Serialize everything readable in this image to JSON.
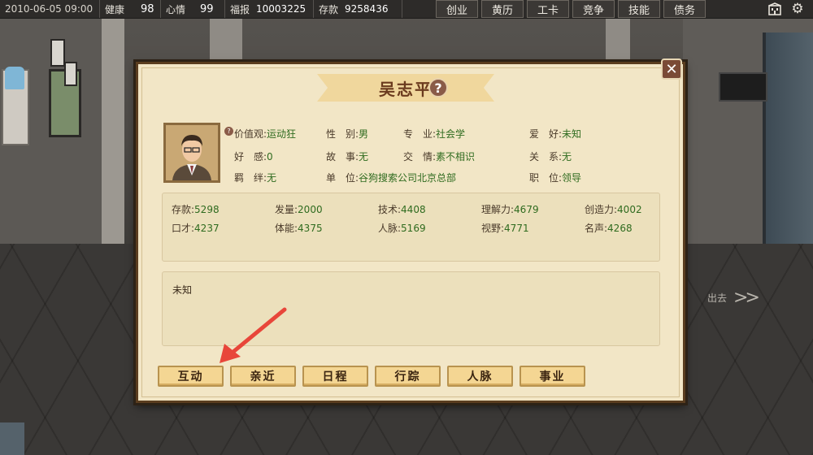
{
  "topbar": {
    "datetime": "2010-06-05 09:00",
    "health_label": "健康",
    "health_value": "98",
    "mood_label": "心情",
    "mood_value": "99",
    "fortune_label": "福报",
    "fortune_value": "10003225",
    "savings_label": "存款",
    "savings_value": "9258436",
    "menu": [
      "创业",
      "黄历",
      "工卡",
      "竞争",
      "技能",
      "债务"
    ]
  },
  "dialog": {
    "name": "吴志平",
    "info": {
      "values_label": "价值观:",
      "values_value": "运动狂",
      "gender_label": "性　别:",
      "gender_value": "男",
      "major_label": "专　业:",
      "major_value": "社会学",
      "hobby_label": "爱　好:",
      "hobby_value": "未知",
      "favor_label": "好　感:",
      "favor_value": "0",
      "story_label": "故　事:",
      "story_value": "无",
      "acq_label": "交　情:",
      "acq_value": "素不相识",
      "relation_label": "关　系:",
      "relation_value": "无",
      "bond_label": "羁　绊:",
      "bond_value": "无",
      "company_label": "单　位:",
      "company_value": "谷狗搜索公司北京总部",
      "position_label": "职　位:",
      "position_value": "领导"
    },
    "stats": [
      {
        "label": "存款:",
        "value": "5298"
      },
      {
        "label": "发量:",
        "value": "2000"
      },
      {
        "label": "技术:",
        "value": "4408"
      },
      {
        "label": "理解力:",
        "value": "4679"
      },
      {
        "label": "创造力:",
        "value": "4002"
      },
      {
        "label": "口才:",
        "value": "4237"
      },
      {
        "label": "体能:",
        "value": "4375"
      },
      {
        "label": "人脉:",
        "value": "5169"
      },
      {
        "label": "视野:",
        "value": "4771"
      },
      {
        "label": "名声:",
        "value": "4268"
      }
    ],
    "description": "未知",
    "actions": [
      "互动",
      "亲近",
      "日程",
      "行踪",
      "人脉",
      "事业"
    ]
  },
  "exit_label": "出去",
  "colors": {
    "dialog_bg": "#f2e6c6",
    "value_green": "#2f6b1f",
    "annotation_red": "#e8463a"
  },
  "icons": [
    "building-icon",
    "gear-icon",
    "close-icon",
    "help-icon",
    "exit-arrow-icon"
  ]
}
